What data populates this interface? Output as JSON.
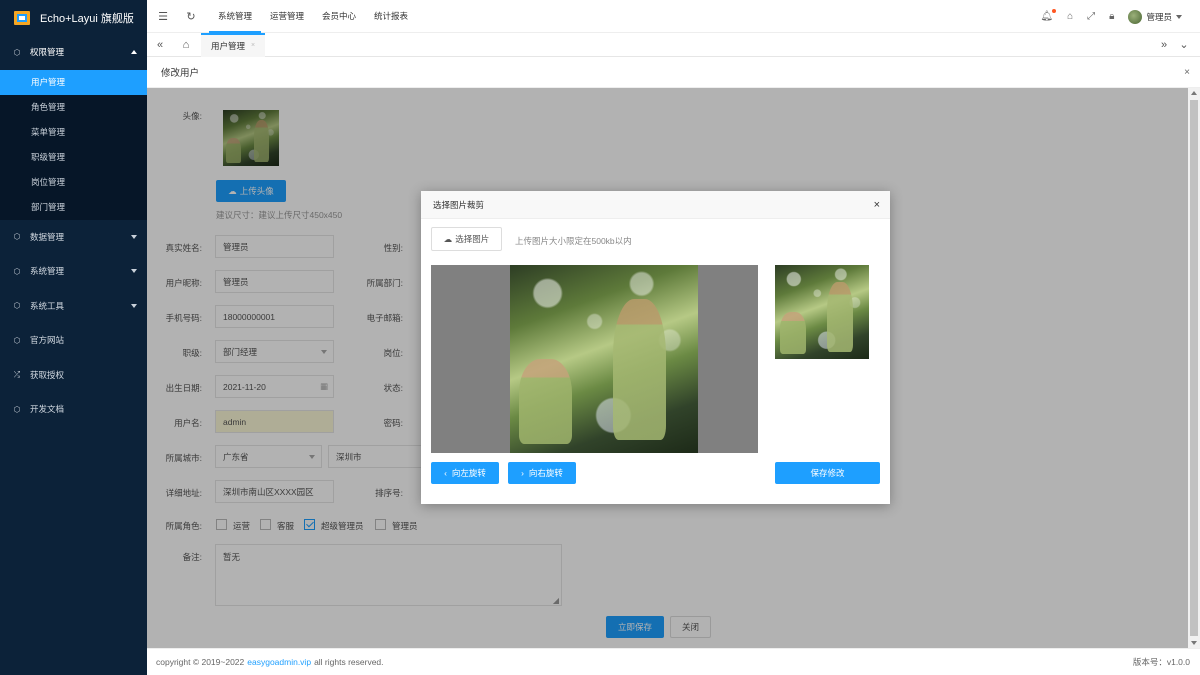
{
  "app": {
    "title": "Echo+Layui 旗舰版"
  },
  "sidebar": {
    "groups": [
      {
        "label": "权限管理",
        "icon": "cube-icon",
        "expanded": true,
        "items": [
          "用户管理",
          "角色管理",
          "菜单管理",
          "职级管理",
          "岗位管理",
          "部门管理"
        ],
        "active": "用户管理"
      },
      {
        "label": "数据管理",
        "icon": "cube-icon"
      },
      {
        "label": "系统管理",
        "icon": "cube-icon"
      },
      {
        "label": "系统工具",
        "icon": "cube-icon"
      },
      {
        "label": "官方网站",
        "icon": "cube-icon"
      },
      {
        "label": "获取授权",
        "icon": "shuffle-icon"
      },
      {
        "label": "开发文档",
        "icon": "cube-icon"
      }
    ]
  },
  "topbar": {
    "nav": [
      "系统管理",
      "运营管理",
      "会员中心",
      "统计报表"
    ],
    "active_nav": "系统管理",
    "user": "管理员"
  },
  "tabs": {
    "active": "用户管理",
    "close": "×"
  },
  "page": {
    "title": "修改用户",
    "close": "×"
  },
  "form": {
    "avatar_label": "头像:",
    "upload_button": "上传头像",
    "upload_hint": "建议尺寸：建议上传尺寸450x450",
    "realname_label": "真实姓名:",
    "realname": "管理员",
    "gender_label": "性别:",
    "nickname_label": "用户昵称:",
    "nickname": "管理员",
    "dept_label": "所属部门:",
    "phone_label": "手机号码:",
    "phone": "18000000001",
    "email_label": "电子邮箱:",
    "level_label": "职级:",
    "level": "部门经理",
    "post_label": "岗位:",
    "birthday_label": "出生日期:",
    "birthday": "2021-11-20",
    "status_label": "状态:",
    "username_label": "用户名:",
    "username": "admin",
    "password_label": "密码:",
    "city_label": "所属城市:",
    "province": "广东省",
    "city": "深圳市",
    "address_label": "详细地址:",
    "address": "深圳市南山区XXXX园区",
    "sort_label": "排序号:",
    "roles_label": "所属角色:",
    "roles": [
      {
        "label": "运营",
        "checked": false
      },
      {
        "label": "客服",
        "checked": false
      },
      {
        "label": "超级管理员",
        "checked": true
      },
      {
        "label": "管理员",
        "checked": false
      }
    ],
    "note_label": "备注:",
    "note": "暂无",
    "save_button": "立即保存",
    "close_button": "关闭"
  },
  "footer": {
    "copyright_pre": "copyright © 2019~2022",
    "link": "easygoadmin.vip",
    "copyright_post": "all rights reserved.",
    "version": "版本号：v1.0.0"
  },
  "modal": {
    "title": "选择图片裁剪",
    "close": "×",
    "choose_button": "选择图片",
    "hint": "上传图片大小限定在500kb以内",
    "rotate_left": "向左旋转",
    "rotate_right": "向右旋转",
    "save": "保存修改"
  },
  "colors": {
    "primary": "#1e9fff",
    "sidebar": "#0c2239",
    "highlight_input": "#fbf8d7"
  }
}
